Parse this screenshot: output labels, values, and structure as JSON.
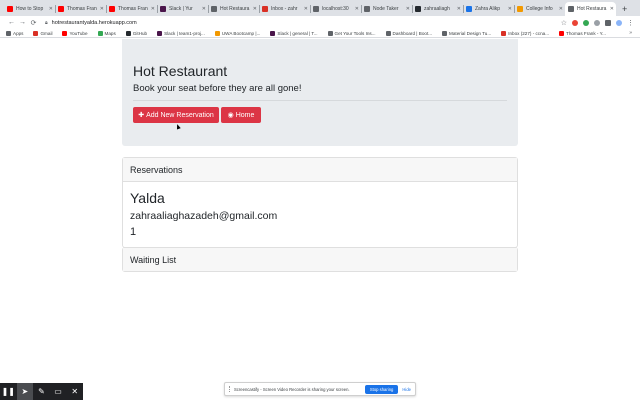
{
  "browser": {
    "tabs": [
      {
        "title": "How to Stop",
        "color": "#ff0000"
      },
      {
        "title": "Thomas Fran",
        "color": "#ff0000"
      },
      {
        "title": "Thomas Fran",
        "color": "#ff0000"
      },
      {
        "title": "Slack | Yur",
        "color": "#4a154b"
      },
      {
        "title": "Hot Restaura",
        "color": "#5f6368"
      },
      {
        "title": "Inbox - zahr",
        "color": "#d93025"
      },
      {
        "title": "localhost:30",
        "color": "#5f6368"
      },
      {
        "title": "Node Taker",
        "color": "#5f6368"
      },
      {
        "title": "zahraaliagh",
        "color": "#24292e"
      },
      {
        "title": "Zahra Alikp",
        "color": "#1a73e8"
      },
      {
        "title": "College Info",
        "color": "#f29900"
      },
      {
        "title": "Hot Restaura",
        "color": "#5f6368",
        "active": true
      }
    ],
    "new_tab": "+",
    "url": "hotrestaurantyalda.herokuapp.com",
    "bookmarks": [
      {
        "label": "Apps",
        "color": "#5f6368"
      },
      {
        "label": "Gmail",
        "color": "#d93025"
      },
      {
        "label": "YouTube",
        "color": "#ff0000"
      },
      {
        "label": "Maps",
        "color": "#34a853"
      },
      {
        "label": "GitHub",
        "color": "#24292e"
      },
      {
        "label": "Slack | team1-proj...",
        "color": "#4a154b"
      },
      {
        "label": "UWA Bootcamp |...",
        "color": "#f29900"
      },
      {
        "label": "Slack | general | T...",
        "color": "#4a154b"
      },
      {
        "label": "Get Your Tools Ins...",
        "color": "#5f6368"
      },
      {
        "label": "Dashboard | Boot...",
        "color": "#5f6368"
      },
      {
        "label": "Material Design Tu...",
        "color": "#5f6368"
      },
      {
        "label": "Inbox (227) - ccna...",
        "color": "#d93025"
      },
      {
        "label": "Thomas Frank - Y...",
        "color": "#ff0000"
      }
    ],
    "bookmarks_more": "»"
  },
  "hero": {
    "title": "Hot Restaurant",
    "subtitle": "Book your seat before they are all gone!",
    "add_button": "Add New Reservation",
    "home_button": "Home"
  },
  "reservations": {
    "header": "Reservations",
    "name": "Yalda",
    "email": "zahraaliaghazadeh@gmail.com",
    "number": "1"
  },
  "waiting": {
    "header": "Waiting List"
  },
  "screencastify": {
    "message": "Screencastify - Screen Video Recorder is sharing your screen.",
    "stop": "Stop sharing",
    "hide": "Hide"
  },
  "colors": {
    "accent": "#dc3545",
    "jumbotron": "#e9ecef"
  }
}
